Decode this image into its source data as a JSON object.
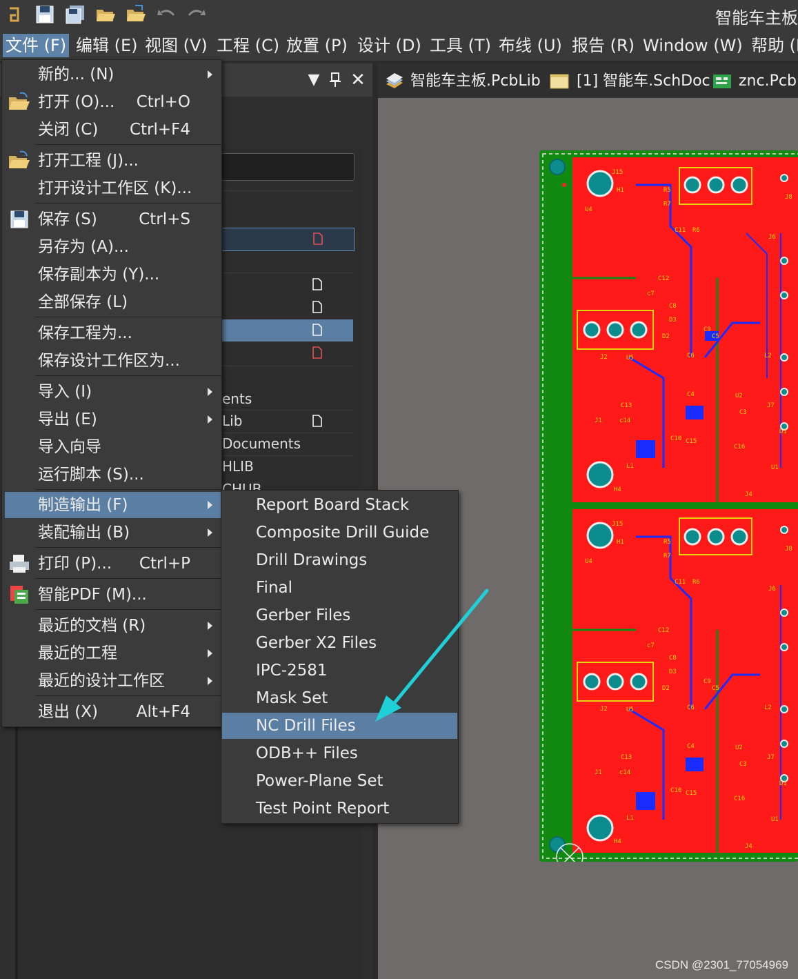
{
  "app_title": "智能车主板",
  "menubar": [
    {
      "label": "文件 (F)",
      "active": true
    },
    {
      "label": "编辑 (E)"
    },
    {
      "label": "视图 (V)"
    },
    {
      "label": "工程 (C)"
    },
    {
      "label": "放置 (P)"
    },
    {
      "label": "设计 (D)"
    },
    {
      "label": "工具 (T)"
    },
    {
      "label": "布线 (U)"
    },
    {
      "label": "报告 (R)"
    },
    {
      "label": "Window (W)"
    },
    {
      "label": "帮助 (H)"
    }
  ],
  "tabs": [
    {
      "label": "智能车主板.PcbLib",
      "icon": "pcblib-icon"
    },
    {
      "label": "[1] 智能车.SchDoc",
      "icon": "schdoc-icon"
    },
    {
      "label": "znc.PcbDoc",
      "icon": "pcbdoc-icon"
    }
  ],
  "panel": {
    "rows": [
      "ents",
      "Lib",
      "Documents",
      "HLIB",
      "CHUB"
    ]
  },
  "file_menu": {
    "items": [
      {
        "label": "新的... (N)",
        "shortcut": "",
        "submenu": true,
        "icon": ""
      },
      {
        "label": "打开 (O)...",
        "shortcut": "Ctrl+O",
        "icon": "folder-open-icon"
      },
      {
        "label": "关闭 (C)",
        "shortcut": "Ctrl+F4",
        "icon": ""
      },
      {
        "label": "打开工程 (J)...",
        "shortcut": "",
        "icon": "open-project-icon"
      },
      {
        "label": "打开设计工作区 (K)...",
        "shortcut": "",
        "icon": ""
      },
      {
        "label": "保存 (S)",
        "shortcut": "Ctrl+S",
        "icon": "save-icon"
      },
      {
        "label": "另存为 (A)...",
        "shortcut": "",
        "icon": ""
      },
      {
        "label": "保存副本为 (Y)...",
        "shortcut": "",
        "icon": ""
      },
      {
        "label": "全部保存 (L)",
        "shortcut": "",
        "icon": ""
      },
      {
        "label": "保存工程为...",
        "shortcut": "",
        "icon": ""
      },
      {
        "label": "保存设计工作区为...",
        "shortcut": "",
        "icon": ""
      },
      {
        "label": "导入 (I)",
        "shortcut": "",
        "submenu": true,
        "icon": ""
      },
      {
        "label": "导出 (E)",
        "shortcut": "",
        "submenu": true,
        "icon": ""
      },
      {
        "label": "导入向导",
        "shortcut": "",
        "icon": ""
      },
      {
        "label": "运行脚本 (S)...",
        "shortcut": "",
        "icon": ""
      },
      {
        "label": "制造输出 (F)",
        "shortcut": "",
        "submenu": true,
        "selected": true,
        "icon": ""
      },
      {
        "label": "装配输出 (B)",
        "shortcut": "",
        "submenu": true,
        "icon": ""
      },
      {
        "label": "打印 (P)...",
        "shortcut": "Ctrl+P",
        "icon": "printer-icon"
      },
      {
        "label": "智能PDF (M)...",
        "shortcut": "",
        "icon": "smart-pdf-icon"
      },
      {
        "label": "最近的文档 (R)",
        "shortcut": "",
        "submenu": true,
        "icon": ""
      },
      {
        "label": "最近的工程",
        "shortcut": "",
        "submenu": true,
        "icon": ""
      },
      {
        "label": "最近的设计工作区",
        "shortcut": "",
        "submenu": true,
        "icon": ""
      },
      {
        "label": "退出 (X)",
        "shortcut": "Alt+F4",
        "icon": ""
      }
    ]
  },
  "fab_submenu": {
    "items": [
      {
        "label": "Report Board Stack"
      },
      {
        "label": "Composite Drill Guide"
      },
      {
        "label": "Drill Drawings"
      },
      {
        "label": "Final"
      },
      {
        "label": "Gerber Files"
      },
      {
        "label": "Gerber X2 Files"
      },
      {
        "label": "IPC-2581"
      },
      {
        "label": "Mask Set"
      },
      {
        "label": "NC Drill Files",
        "selected": true
      },
      {
        "label": "ODB++ Files"
      },
      {
        "label": "Power-Plane Set"
      },
      {
        "label": "Test Point Report"
      }
    ]
  },
  "pcb_labels": {
    "silk": [
      "J15",
      "H1",
      "R5",
      "R7",
      "U4",
      "J8",
      "C11",
      "R6",
      "J6",
      "C12",
      "c7",
      "C8",
      "D3",
      "D2",
      "C9",
      "C5",
      "C6",
      "J2",
      "U5",
      "L2",
      "C4",
      "U2",
      "C13",
      "C3",
      "J7",
      "J1",
      "c14",
      "C10",
      "C15",
      "D1",
      "C16",
      "L1",
      "U1",
      "H4",
      "J4"
    ]
  },
  "colors": {
    "accent_selection": "#5b7ea3",
    "menu_bg": "#3b3b3b",
    "pcb_green": "#128a12",
    "pcb_red": "#ff1a1a",
    "arrow_cyan": "#1fd0d8"
  },
  "watermark": "CSDN @2301_77054969"
}
